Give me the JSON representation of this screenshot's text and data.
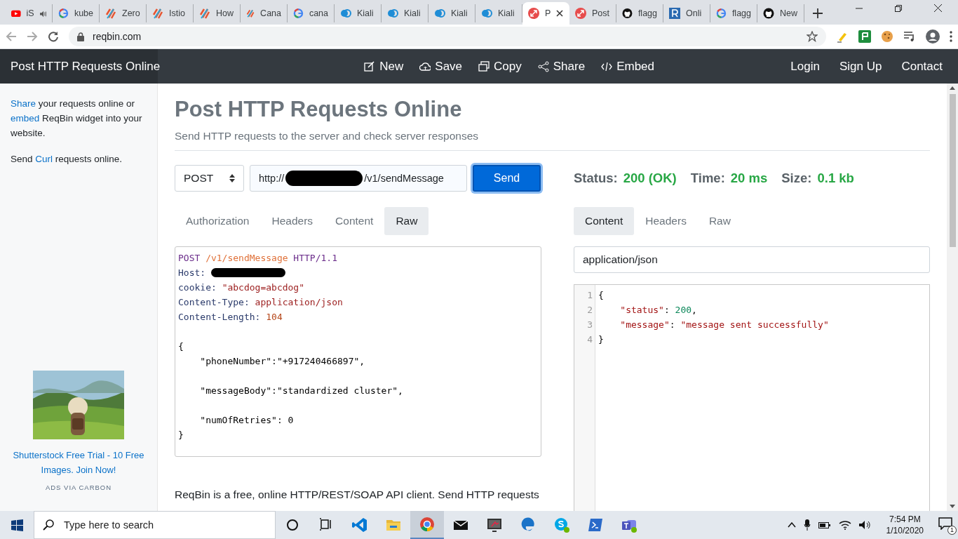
{
  "browser": {
    "tabs": [
      {
        "title": "iS",
        "kind": "youtube",
        "selected": false,
        "audio": true
      },
      {
        "title": "kube",
        "kind": "google",
        "selected": false,
        "audio": false
      },
      {
        "title": "Zero",
        "kind": "stripes",
        "selected": false,
        "audio": false
      },
      {
        "title": "Istio",
        "kind": "stripes",
        "selected": false,
        "audio": false
      },
      {
        "title": "How",
        "kind": "stripes",
        "selected": false,
        "audio": false
      },
      {
        "title": "Cana",
        "kind": "stripes",
        "selected": false,
        "audio": false
      },
      {
        "title": "cana",
        "kind": "google",
        "selected": false,
        "audio": false
      },
      {
        "title": "Kiali",
        "kind": "kiali",
        "selected": false,
        "audio": false
      },
      {
        "title": "Kiali",
        "kind": "kiali",
        "selected": false,
        "audio": false
      },
      {
        "title": "Kiali",
        "kind": "kiali",
        "selected": false,
        "audio": false
      },
      {
        "title": "Kiali",
        "kind": "kiali",
        "selected": false,
        "audio": false
      },
      {
        "title": "P",
        "kind": "reqbin",
        "selected": true,
        "audio": false
      },
      {
        "title": "Post",
        "kind": "reqbin",
        "selected": false,
        "audio": false
      },
      {
        "title": "flagg",
        "kind": "github",
        "selected": false,
        "audio": false
      },
      {
        "title": "Onli",
        "kind": "letter",
        "selected": false,
        "audio": false
      },
      {
        "title": "flagg",
        "kind": "google",
        "selected": false,
        "audio": false
      },
      {
        "title": "New",
        "kind": "github",
        "selected": false,
        "audio": false
      }
    ],
    "address": "reqbin.com"
  },
  "navbar": {
    "brand": "Post HTTP Requests Online",
    "actions": [
      {
        "label": "New",
        "kind": "edit"
      },
      {
        "label": "Save",
        "kind": "cloud"
      },
      {
        "label": "Copy",
        "kind": "copy"
      },
      {
        "label": "Share",
        "kind": "share"
      },
      {
        "label": "Embed",
        "kind": "code"
      }
    ],
    "links": [
      "Login",
      "Sign Up",
      "Contact"
    ]
  },
  "sidebar": {
    "paragraphs": [
      [
        {
          "text": "Share",
          "link": true
        },
        {
          "text": " your requests online or ",
          "link": false
        },
        {
          "text": "embed",
          "link": true
        },
        {
          "text": " ReqBin widget into your website.",
          "link": false
        }
      ],
      [
        {
          "text": "Send ",
          "link": false
        },
        {
          "text": "Curl",
          "link": true
        },
        {
          "text": " requests online.",
          "link": false
        }
      ]
    ],
    "ad": {
      "kind": "picture",
      "caption": "Shutterstock Free Trial - 10 Free Images. Join Now!",
      "footer": "ADS VIA CARBON"
    }
  },
  "page": {
    "title": "Post HTTP Requests Online",
    "subtitle": "Send HTTP requests to the server and check server responses",
    "about": "ReqBin is a free, online HTTP/REST/SOAP API client. Send HTTP requests"
  },
  "request": {
    "method": "POST",
    "url_prefix": "http://",
    "url_suffix": "/v1/sendMessage",
    "send": "Send",
    "tabs": [
      {
        "label": "Authorization",
        "selected": false
      },
      {
        "label": "Headers",
        "selected": false
      },
      {
        "label": "Content",
        "selected": false
      },
      {
        "label": "Raw",
        "selected": true
      }
    ],
    "raw_lines": [
      {
        "kind": "code",
        "segments": [
          {
            "kind": "method",
            "text": "POST "
          },
          {
            "kind": "path",
            "text": "/v1/sendMessage"
          },
          {
            "kind": "method",
            "text": " HTTP/1.1"
          }
        ]
      },
      {
        "kind": "code",
        "segments": [
          {
            "kind": "header",
            "text": "Host: "
          },
          {
            "kind": "redacted"
          }
        ]
      },
      {
        "kind": "code",
        "segments": [
          {
            "kind": "header",
            "text": "cookie: "
          },
          {
            "kind": "value",
            "text": "\"abcdog=abcdog\""
          }
        ]
      },
      {
        "kind": "code",
        "segments": [
          {
            "kind": "header",
            "text": "Content-Type: "
          },
          {
            "kind": "value",
            "text": "application/json"
          }
        ]
      },
      {
        "kind": "code",
        "segments": [
          {
            "kind": "header",
            "text": "Content-Length: "
          },
          {
            "kind": "number",
            "text": "104"
          }
        ]
      },
      {
        "kind": "blank"
      },
      {
        "kind": "code",
        "segments": [
          {
            "kind": "plain",
            "text": "{"
          }
        ]
      },
      {
        "kind": "code",
        "segments": [
          {
            "kind": "plain",
            "text": "    \"phoneNumber\":\"+917240466897\","
          }
        ]
      },
      {
        "kind": "blank"
      },
      {
        "kind": "code",
        "segments": [
          {
            "kind": "plain",
            "text": "    \"messageBody\":\"standardized cluster\","
          }
        ]
      },
      {
        "kind": "blank"
      },
      {
        "kind": "code",
        "segments": [
          {
            "kind": "plain",
            "text": "    \"numOfRetries\": 0"
          }
        ]
      },
      {
        "kind": "code",
        "segments": [
          {
            "kind": "plain",
            "text": "}"
          }
        ]
      }
    ]
  },
  "response": {
    "status_label": "Status:",
    "status": "200 (OK)",
    "time_label": "Time:",
    "time": "20 ms",
    "size_label": "Size:",
    "size": "0.1 kb",
    "tabs": [
      {
        "label": "Content",
        "selected": true
      },
      {
        "label": "Headers",
        "selected": false
      },
      {
        "label": "Raw",
        "selected": false
      }
    ],
    "content_type": "application/json",
    "lines": [
      {
        "number": "1",
        "segments": [
          {
            "kind": "plain",
            "text": "{"
          }
        ]
      },
      {
        "number": "2",
        "segments": [
          {
            "kind": "key",
            "text": "    \"status\""
          },
          {
            "kind": "plain",
            "text": ": "
          },
          {
            "kind": "number",
            "text": "200"
          },
          {
            "kind": "plain",
            "text": ","
          }
        ]
      },
      {
        "number": "3",
        "segments": [
          {
            "kind": "key",
            "text": "    \"message\""
          },
          {
            "kind": "plain",
            "text": ": "
          },
          {
            "kind": "string",
            "text": "\"message sent successfully\""
          }
        ]
      },
      {
        "number": "4",
        "segments": [
          {
            "kind": "plain",
            "text": "}"
          }
        ]
      }
    ]
  },
  "taskbar": {
    "search_placeholder": "Type here to search",
    "apps": [
      {
        "kind": "cortana",
        "selected": false
      },
      {
        "kind": "taskview",
        "selected": false
      },
      {
        "kind": "vscode",
        "selected": false
      },
      {
        "kind": "folder",
        "selected": false
      },
      {
        "kind": "chrome",
        "selected": true
      },
      {
        "kind": "mail",
        "selected": false
      },
      {
        "kind": "monitor",
        "selected": false
      },
      {
        "kind": "edge",
        "selected": false
      },
      {
        "kind": "skype",
        "selected": false
      },
      {
        "kind": "terminal",
        "selected": false
      },
      {
        "kind": "teams",
        "selected": false
      }
    ],
    "time": "7:54 PM",
    "date": "1/10/2020",
    "notifications": "1"
  }
}
